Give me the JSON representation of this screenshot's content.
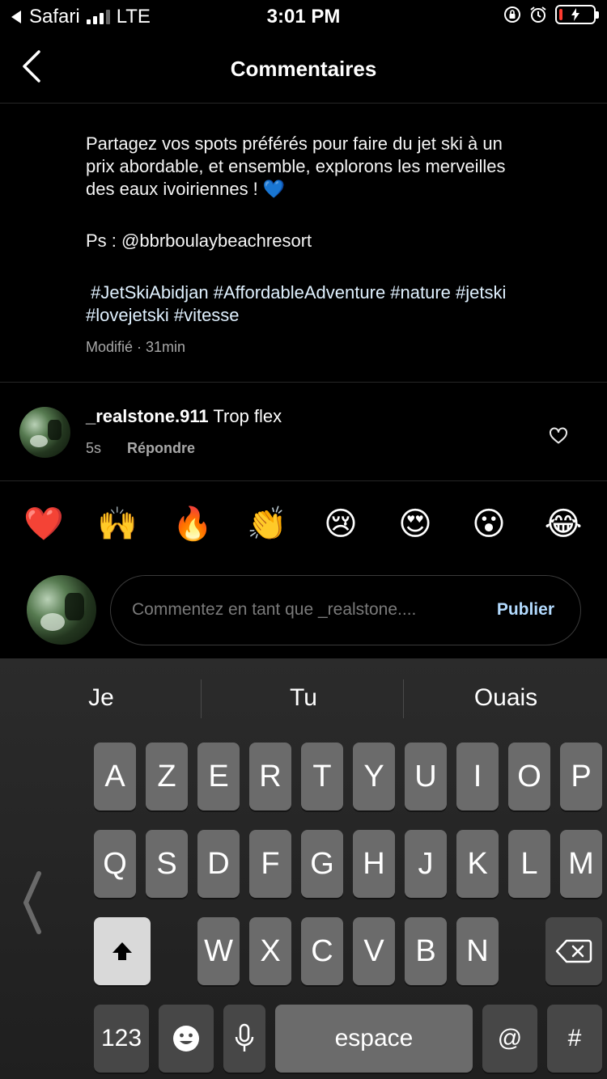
{
  "status_bar": {
    "back_app": "Safari",
    "network": "LTE",
    "time": "3:01 PM"
  },
  "header": {
    "title": "Commentaires"
  },
  "caption": {
    "line1": "Partagez vos spots préférés pour faire du jet ski à un",
    "line2": "prix abordable, et ensemble, explorons les merveilles",
    "line3": "des eaux ivoiriennes ! 💙",
    "ps": "Ps : @bbrboulaybeachresort",
    "hashtags1": " #JetSkiAbidjan #AffordableAdventure #nature #jetski",
    "hashtags2": "#lovejetski #vitesse",
    "meta": "Modifié · 31min"
  },
  "comment": {
    "username": "_realstone.911",
    "text": " Trop flex",
    "time": "5s",
    "reply_label": "Répondre"
  },
  "emojis": [
    "❤️",
    "🙌",
    "🔥",
    "👏",
    "😢",
    "😍",
    "😮",
    "😂"
  ],
  "composer": {
    "placeholder": "Commentez en tant que _realstone....",
    "publish_label": "Publier"
  },
  "keyboard": {
    "suggestions": [
      "Je",
      "Tu",
      "Ouais"
    ],
    "row1": [
      "A",
      "Z",
      "E",
      "R",
      "T",
      "Y",
      "U",
      "I",
      "O",
      "P"
    ],
    "row2": [
      "Q",
      "S",
      "D",
      "F",
      "G",
      "H",
      "J",
      "K",
      "L",
      "M"
    ],
    "row3": [
      "W",
      "X",
      "C",
      "V",
      "B",
      "N"
    ],
    "numbers_label": "123",
    "space_label": "espace",
    "at_label": "@",
    "hash_label": "#"
  }
}
